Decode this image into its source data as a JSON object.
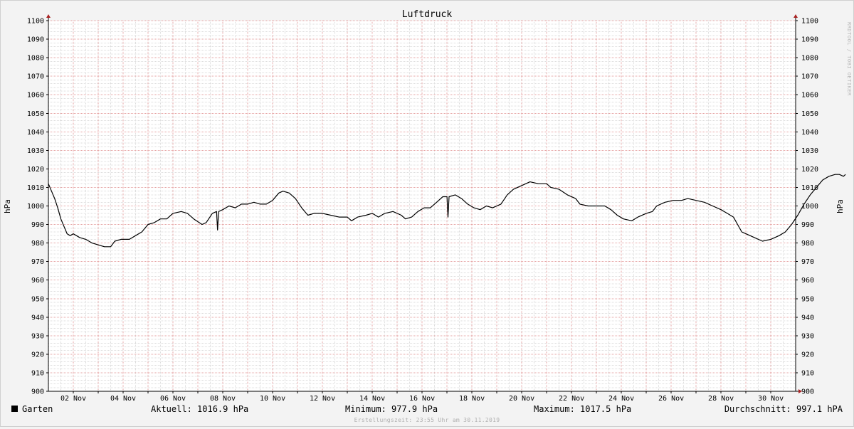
{
  "chart_data": {
    "type": "line",
    "title": "Luftdruck",
    "ylabel_left": "hPa",
    "ylabel_right": "hPa",
    "ylim": [
      900,
      1100
    ],
    "y_ticks": [
      900,
      910,
      920,
      930,
      940,
      950,
      960,
      970,
      980,
      990,
      1000,
      1010,
      1020,
      1030,
      1040,
      1050,
      1060,
      1070,
      1080,
      1090,
      1100
    ],
    "xlim": [
      "2019-11-01T00:00",
      "2019-11-30T23:55"
    ],
    "x_ticks": [
      {
        "label": "02 Nov",
        "date": "2019-11-02"
      },
      {
        "label": "04 Nov",
        "date": "2019-11-04"
      },
      {
        "label": "06 Nov",
        "date": "2019-11-06"
      },
      {
        "label": "08 Nov",
        "date": "2019-11-08"
      },
      {
        "label": "10 Nov",
        "date": "2019-11-10"
      },
      {
        "label": "12 Nov",
        "date": "2019-11-12"
      },
      {
        "label": "14 Nov",
        "date": "2019-11-14"
      },
      {
        "label": "16 Nov",
        "date": "2019-11-16"
      },
      {
        "label": "18 Nov",
        "date": "2019-11-18"
      },
      {
        "label": "20 Nov",
        "date": "2019-11-20"
      },
      {
        "label": "22 Nov",
        "date": "2019-11-22"
      },
      {
        "label": "24 Nov",
        "date": "2019-11-24"
      },
      {
        "label": "26 Nov",
        "date": "2019-11-26"
      },
      {
        "label": "28 Nov",
        "date": "2019-11-28"
      },
      {
        "label": "30 Nov",
        "date": "2019-11-30"
      }
    ],
    "grid": true,
    "legend_position": "bottom-left",
    "series": [
      {
        "name": "Garten",
        "color": "#000000",
        "points": [
          [
            "2019-11-01T00:00",
            1012
          ],
          [
            "2019-11-01T03:00",
            1008
          ],
          [
            "2019-11-01T06:00",
            1004
          ],
          [
            "2019-11-01T09:00",
            999
          ],
          [
            "2019-11-01T12:00",
            993
          ],
          [
            "2019-11-01T15:00",
            989
          ],
          [
            "2019-11-01T18:00",
            985
          ],
          [
            "2019-11-01T21:00",
            984
          ],
          [
            "2019-11-02T00:00",
            985
          ],
          [
            "2019-11-02T03:00",
            984
          ],
          [
            "2019-11-02T06:00",
            983
          ],
          [
            "2019-11-02T12:00",
            982
          ],
          [
            "2019-11-02T18:00",
            980
          ],
          [
            "2019-11-03T00:00",
            979
          ],
          [
            "2019-11-03T06:00",
            978
          ],
          [
            "2019-11-03T12:00",
            978
          ],
          [
            "2019-11-03T16:00",
            981
          ],
          [
            "2019-11-03T22:00",
            982
          ],
          [
            "2019-11-04T06:00",
            982
          ],
          [
            "2019-11-04T12:00",
            984
          ],
          [
            "2019-11-04T18:00",
            986
          ],
          [
            "2019-11-05T00:00",
            990
          ],
          [
            "2019-11-05T06:00",
            991
          ],
          [
            "2019-11-05T12:00",
            993
          ],
          [
            "2019-11-05T18:00",
            993
          ],
          [
            "2019-11-06T00:00",
            996
          ],
          [
            "2019-11-06T08:00",
            997
          ],
          [
            "2019-11-06T14:00",
            996
          ],
          [
            "2019-11-06T20:00",
            993
          ],
          [
            "2019-11-07T04:00",
            990
          ],
          [
            "2019-11-07T08:00",
            991
          ],
          [
            "2019-11-07T14:00",
            996
          ],
          [
            "2019-11-07T18:00",
            997
          ],
          [
            "2019-11-07T19:00",
            987
          ],
          [
            "2019-11-07T20:00",
            997
          ],
          [
            "2019-11-08T00:00",
            998
          ],
          [
            "2019-11-08T06:00",
            1000
          ],
          [
            "2019-11-08T12:00",
            999
          ],
          [
            "2019-11-08T18:00",
            1001
          ],
          [
            "2019-11-09T00:00",
            1001
          ],
          [
            "2019-11-09T06:00",
            1002
          ],
          [
            "2019-11-09T12:00",
            1001
          ],
          [
            "2019-11-09T18:00",
            1001
          ],
          [
            "2019-11-10T00:00",
            1003
          ],
          [
            "2019-11-10T06:00",
            1007
          ],
          [
            "2019-11-10T10:00",
            1008
          ],
          [
            "2019-11-10T16:00",
            1007
          ],
          [
            "2019-11-10T22:00",
            1004
          ],
          [
            "2019-11-11T04:00",
            999
          ],
          [
            "2019-11-11T10:00",
            995
          ],
          [
            "2019-11-11T16:00",
            996
          ],
          [
            "2019-11-12T00:00",
            996
          ],
          [
            "2019-11-12T08:00",
            995
          ],
          [
            "2019-11-12T16:00",
            994
          ],
          [
            "2019-11-13T00:00",
            994
          ],
          [
            "2019-11-13T04:00",
            992
          ],
          [
            "2019-11-13T10:00",
            994
          ],
          [
            "2019-11-13T18:00",
            995
          ],
          [
            "2019-11-14T00:00",
            996
          ],
          [
            "2019-11-14T06:00",
            994
          ],
          [
            "2019-11-14T12:00",
            996
          ],
          [
            "2019-11-14T20:00",
            997
          ],
          [
            "2019-11-15T04:00",
            995
          ],
          [
            "2019-11-15T08:00",
            993
          ],
          [
            "2019-11-15T14:00",
            994
          ],
          [
            "2019-11-15T20:00",
            997
          ],
          [
            "2019-11-16T02:00",
            999
          ],
          [
            "2019-11-16T08:00",
            999
          ],
          [
            "2019-11-16T14:00",
            1002
          ],
          [
            "2019-11-16T20:00",
            1005
          ],
          [
            "2019-11-17T00:00",
            1005
          ],
          [
            "2019-11-17T01:00",
            994
          ],
          [
            "2019-11-17T02:00",
            1005
          ],
          [
            "2019-11-17T08:00",
            1006
          ],
          [
            "2019-11-17T14:00",
            1004
          ],
          [
            "2019-11-17T20:00",
            1001
          ],
          [
            "2019-11-18T02:00",
            999
          ],
          [
            "2019-11-18T08:00",
            998
          ],
          [
            "2019-11-18T14:00",
            1000
          ],
          [
            "2019-11-18T20:00",
            999
          ],
          [
            "2019-11-19T04:00",
            1001
          ],
          [
            "2019-11-19T10:00",
            1006
          ],
          [
            "2019-11-19T16:00",
            1009
          ],
          [
            "2019-11-20T00:00",
            1011
          ],
          [
            "2019-11-20T08:00",
            1013
          ],
          [
            "2019-11-20T16:00",
            1012
          ],
          [
            "2019-11-21T00:00",
            1012
          ],
          [
            "2019-11-21T04:00",
            1010
          ],
          [
            "2019-11-21T12:00",
            1009
          ],
          [
            "2019-11-21T20:00",
            1006
          ],
          [
            "2019-11-22T04:00",
            1004
          ],
          [
            "2019-11-22T08:00",
            1001
          ],
          [
            "2019-11-22T16:00",
            1000
          ],
          [
            "2019-11-23T00:00",
            1000
          ],
          [
            "2019-11-23T08:00",
            1000
          ],
          [
            "2019-11-23T14:00",
            998
          ],
          [
            "2019-11-23T20:00",
            995
          ],
          [
            "2019-11-24T02:00",
            993
          ],
          [
            "2019-11-24T10:00",
            992
          ],
          [
            "2019-11-24T16:00",
            994
          ],
          [
            "2019-11-25T00:00",
            996
          ],
          [
            "2019-11-25T06:00",
            997
          ],
          [
            "2019-11-25T10:00",
            1000
          ],
          [
            "2019-11-25T18:00",
            1002
          ],
          [
            "2019-11-26T02:00",
            1003
          ],
          [
            "2019-11-26T10:00",
            1003
          ],
          [
            "2019-11-26T16:00",
            1004
          ],
          [
            "2019-11-27T00:00",
            1003
          ],
          [
            "2019-11-27T08:00",
            1002
          ],
          [
            "2019-11-27T16:00",
            1000
          ],
          [
            "2019-11-28T00:00",
            998
          ],
          [
            "2019-11-28T06:00",
            996
          ],
          [
            "2019-11-28T12:00",
            994
          ],
          [
            "2019-11-28T16:00",
            990
          ],
          [
            "2019-11-28T20:00",
            986
          ],
          [
            "2019-11-29T00:00",
            985
          ],
          [
            "2019-11-29T08:00",
            983
          ],
          [
            "2019-11-29T16:00",
            981
          ],
          [
            "2019-11-30T00:00",
            982
          ],
          [
            "2019-11-30T08:00",
            984
          ],
          [
            "2019-11-30T14:00",
            986
          ],
          [
            "2019-11-30T20:00",
            990
          ],
          [
            "2019-12-01T02:00",
            995
          ],
          [
            "2019-12-01T08:00",
            1001
          ],
          [
            "2019-12-01T14:00",
            1006
          ],
          [
            "2019-12-01T20:00",
            1010
          ],
          [
            "2019-12-02T02:00",
            1014
          ],
          [
            "2019-12-02T08:00",
            1016
          ],
          [
            "2019-12-02T14:00",
            1017
          ],
          [
            "2019-12-02T18:00",
            1017
          ],
          [
            "2019-12-02T22:00",
            1016
          ],
          [
            "2019-12-03T00:00",
            1017
          ]
        ]
      }
    ]
  },
  "legend": {
    "label": "Garten",
    "color": "#000000"
  },
  "stats": {
    "current": "Aktuell: 1016.9 hPa",
    "minimum": "Minimum: 977.9 hPa",
    "maximum": "Maximum: 1017.5 hPa",
    "average": "Durchschnitt: 997.1 hPA"
  },
  "watermark": "RRDTOOL / TOBI OETIKER",
  "created": "Erstellungszeit: 23:55 Uhr am 30.11.2019",
  "colors": {
    "background": "#f3f3f3",
    "plot_background": "#ffffff",
    "major_grid": "#e6a3a3",
    "minor_grid": "#dcdcdc",
    "axis": "#000000",
    "arrow": "#aa2222"
  }
}
